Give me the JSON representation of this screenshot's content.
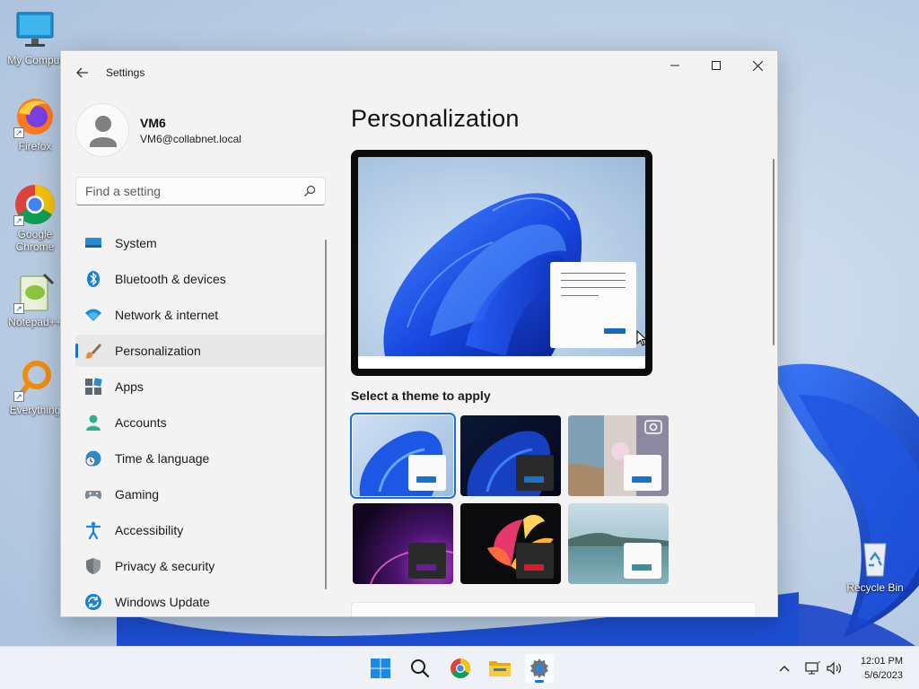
{
  "desktop": {
    "icons": [
      {
        "label": "My Comput",
        "icon": "monitor-icon"
      },
      {
        "label": "Firefox",
        "icon": "firefox-icon"
      },
      {
        "label": "Google Chrome",
        "icon": "chrome-icon"
      },
      {
        "label": "Notepad++",
        "icon": "notepad-plus-plus-icon"
      },
      {
        "label": "Everything",
        "icon": "everything-search-icon"
      },
      {
        "label": "Recycle Bin",
        "icon": "recycle-bin-icon"
      }
    ]
  },
  "window": {
    "title": "Settings",
    "controls": {
      "minimize": "minimize-icon",
      "maximize": "maximize-icon",
      "close": "close-icon"
    }
  },
  "profile": {
    "name": "VM6",
    "email": "VM6@collabnet.local"
  },
  "search": {
    "placeholder": "Find a setting",
    "value": ""
  },
  "sidebar": {
    "items": [
      {
        "label": "System",
        "icon": "system-icon",
        "active": false
      },
      {
        "label": "Bluetooth & devices",
        "icon": "bluetooth-icon",
        "active": false
      },
      {
        "label": "Network & internet",
        "icon": "wifi-icon",
        "active": false
      },
      {
        "label": "Personalization",
        "icon": "paintbrush-icon",
        "active": true
      },
      {
        "label": "Apps",
        "icon": "apps-icon",
        "active": false
      },
      {
        "label": "Accounts",
        "icon": "accounts-icon",
        "active": false
      },
      {
        "label": "Time & language",
        "icon": "time-language-icon",
        "active": false
      },
      {
        "label": "Gaming",
        "icon": "gamepad-icon",
        "active": false
      },
      {
        "label": "Accessibility",
        "icon": "accessibility-icon",
        "active": false
      },
      {
        "label": "Privacy & security",
        "icon": "shield-icon",
        "active": false
      },
      {
        "label": "Windows Update",
        "icon": "windows-update-icon",
        "active": false
      }
    ]
  },
  "main": {
    "title": "Personalization",
    "themes_label": "Select a theme to apply",
    "themes": [
      {
        "id": "windows-light",
        "selected": true,
        "accent": "#1a73c9"
      },
      {
        "id": "windows-dark",
        "selected": false,
        "accent": "#1a73c9"
      },
      {
        "id": "windows-spotlight",
        "selected": false,
        "accent": "#1a73c9"
      },
      {
        "id": "glow",
        "selected": false,
        "accent": "#6a1b9a"
      },
      {
        "id": "captured-motion",
        "selected": false,
        "accent": "#d81b2b"
      },
      {
        "id": "flow",
        "selected": false,
        "accent": "#3d8f9a"
      }
    ]
  },
  "taskbar": {
    "apps": [
      {
        "name": "start",
        "icon": "windows-start-icon"
      },
      {
        "name": "search",
        "icon": "search-icon"
      },
      {
        "name": "chrome",
        "icon": "chrome-icon"
      },
      {
        "name": "file-explorer",
        "icon": "folder-icon"
      },
      {
        "name": "settings",
        "icon": "gear-icon",
        "active": true
      }
    ],
    "tray": [
      "chevron-up-icon",
      "network-icon",
      "volume-icon"
    ],
    "time": "12:01 PM",
    "date": "5/6/2023"
  },
  "colors": {
    "accent": "#1a73c9",
    "window_bg": "#f3f3f3",
    "taskbar_bg": "#eef2f6"
  }
}
